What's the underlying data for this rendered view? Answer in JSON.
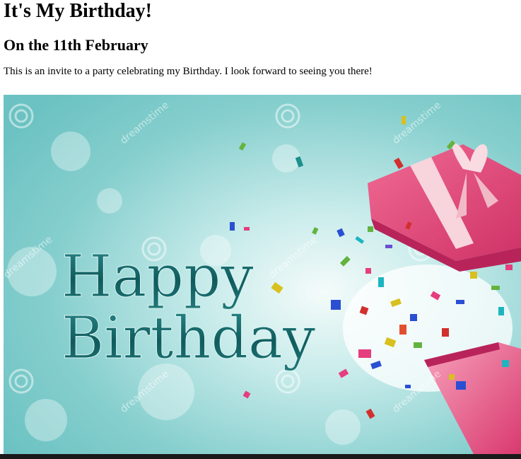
{
  "page": {
    "title": "It's My Birthday!",
    "subtitle": "On the 11th February",
    "description": "This is an invite to a party celebrating my Birthday. I look forward to seeing you there!"
  },
  "banner": {
    "headline_line1": "Happy",
    "headline_line2": "Birthday",
    "watermark": "dreamstime",
    "gift_icon": "gift-box-icon",
    "colors": {
      "background": "#8fd3d3",
      "background_light": "#e4f4f3",
      "text": "#1f6f70",
      "gift": "#e4457a",
      "ribbon": "#f6d2d9"
    }
  }
}
